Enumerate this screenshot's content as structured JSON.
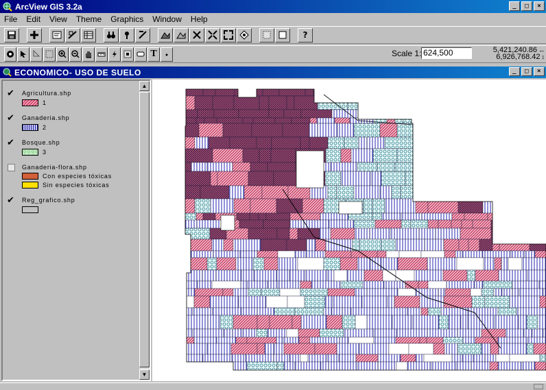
{
  "app": {
    "title": "ArcView GIS 3.2a"
  },
  "window_buttons": {
    "minimize": "_",
    "maximize": "□",
    "close": "×"
  },
  "menu": [
    "File",
    "Edit",
    "View",
    "Theme",
    "Graphics",
    "Window",
    "Help"
  ],
  "toolbar": {
    "scale_label": "Scale 1:",
    "scale_value": "624,500",
    "coord_x": "5,421,240.86",
    "coord_y": "6,926,768.42",
    "text_tool": "T",
    "help_tool": "?"
  },
  "view": {
    "title": "ECONOMICO- USO DE SUELO",
    "themes": [
      {
        "name": "Agricultura.shp",
        "checked": true,
        "legend": [
          {
            "label": "1",
            "swatch": "agri"
          }
        ]
      },
      {
        "name": "Ganaderia.shp",
        "checked": true,
        "legend": [
          {
            "label": "2",
            "swatch": "gan"
          }
        ]
      },
      {
        "name": "Bosque.shp",
        "checked": true,
        "legend": [
          {
            "label": "3",
            "swatch": "bos"
          }
        ]
      },
      {
        "name": "Ganaderia-flora.shp",
        "checked": false,
        "legend": [
          {
            "label": "Con especies tóxicas",
            "swatch": "con"
          },
          {
            "label": "Sin especies tóxicas",
            "swatch": "sin"
          }
        ]
      },
      {
        "name": "Reg_grafico.shp",
        "checked": true,
        "legend": [
          {
            "label": "",
            "swatch": "reg"
          }
        ]
      }
    ]
  },
  "colors": {
    "agricultura": "#c81e50",
    "ganaderia": "#1e1ea0",
    "bosque": "#2f8f2f",
    "con_especies": "#d2603a",
    "sin_especies": "#ffe000"
  },
  "icons": {
    "app": "globe-icon",
    "check": "✔",
    "scroll_up": "▲",
    "scroll_down": "▼"
  }
}
